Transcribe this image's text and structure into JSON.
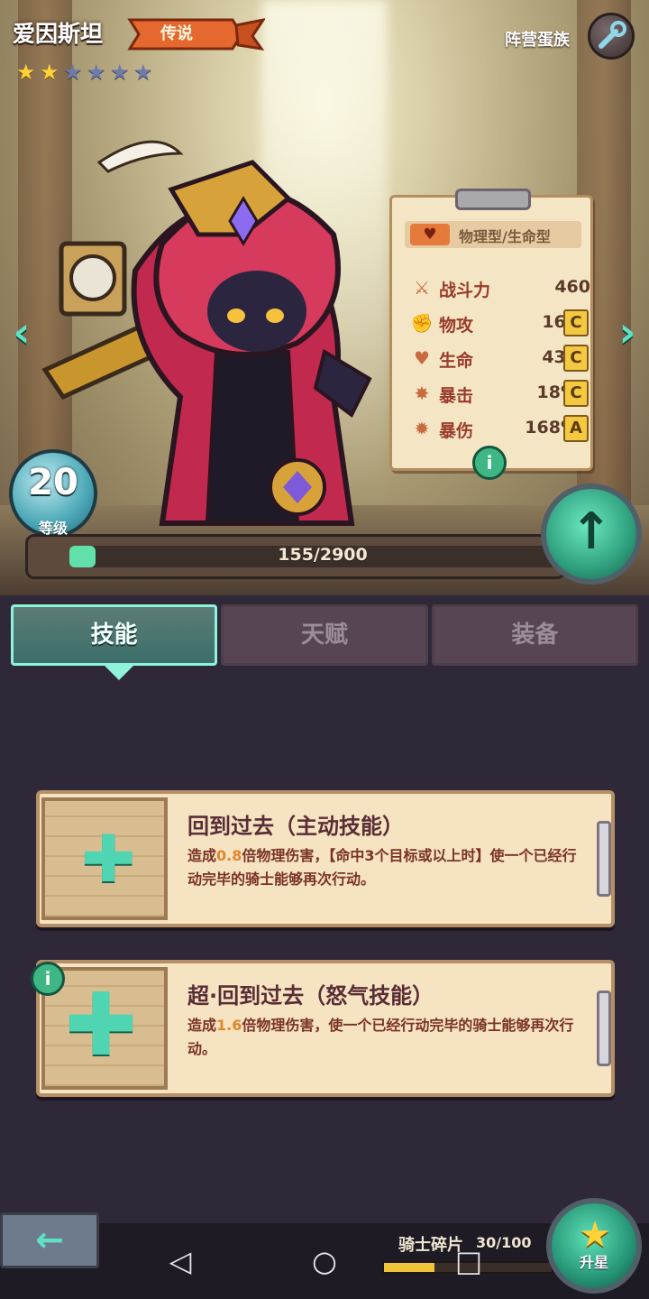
{
  "hero": {
    "name": "爱因斯坦",
    "rarity": "传说",
    "stars_total": 6,
    "stars_filled": 2,
    "faction": "阵营蛋族"
  },
  "stats": {
    "type": "物理型/生命型",
    "rows": [
      {
        "label": "战斗力",
        "value": "460",
        "grade": "",
        "icon": "power-icon"
      },
      {
        "label": "物攻",
        "value": "161",
        "grade": "C",
        "icon": "fist-icon"
      },
      {
        "label": "生命",
        "value": "430",
        "grade": "C",
        "icon": "heart-icon"
      },
      {
        "label": "暴击",
        "value": "18%",
        "grade": "C",
        "icon": "crit-icon"
      },
      {
        "label": "暴伤",
        "value": "168%",
        "grade": "A",
        "icon": "crit-damage-icon"
      }
    ]
  },
  "level": {
    "value": "20",
    "label": "等级",
    "xp_text": "155/2900",
    "xp_fraction": 0.053
  },
  "tabs": [
    {
      "label": "技能",
      "active": true
    },
    {
      "label": "天赋",
      "active": false
    },
    {
      "label": "装备",
      "active": false
    }
  ],
  "skills": [
    {
      "name": "回到过去（主动技能）",
      "desc_pre": "造成",
      "desc_num": "0.8",
      "desc_post": "倍物理伤害，【命中3个目标或以上时】使一个已经行动完毕的骑士能够再次行动。"
    },
    {
      "name": "超·回到过去（怒气技能）",
      "desc_pre": "造成",
      "desc_num": "1.6",
      "desc_post": "倍物理伤害，使一个已经行动完毕的骑士能够再次行动。"
    }
  ],
  "bottom": {
    "shard_label": "骑士碎片",
    "shard_count": "30/100",
    "shard_fraction": 0.3,
    "star_up_label": "升星"
  },
  "colors": {
    "accent": "#5fe1c3",
    "grade_yellow": "#f5c842",
    "skill_num": "#e0872e"
  }
}
